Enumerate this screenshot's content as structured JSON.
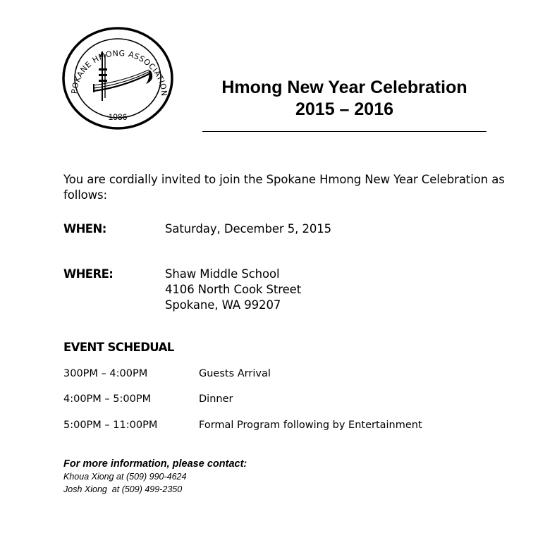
{
  "logo": {
    "arc_text": "SPOKANE HMONG ASSOCIATION",
    "year": "1986"
  },
  "title": {
    "line1": "Hmong New Year Celebration",
    "line2": "2015 – 2016"
  },
  "invitation": "You are cordially invited to join the Spokane Hmong New Year Celebration as follows:",
  "when": {
    "label": "WHEN:",
    "value": "Saturday, December 5, 2015"
  },
  "where": {
    "label": "WHERE:",
    "lines": [
      "Shaw Middle School",
      "4106 North Cook Street",
      "Spokane, WA  99207"
    ]
  },
  "schedule": {
    "heading": "EVENT SCHEDUAL",
    "items": [
      {
        "time": "300PM – 4:00PM",
        "event": "Guests Arrival"
      },
      {
        "time": "4:00PM – 5:00PM",
        "event": "Dinner"
      },
      {
        "time": "5:00PM – 11:00PM",
        "event": "Formal Program following by Entertainment"
      }
    ]
  },
  "contact": {
    "heading": "For more information, please contact:",
    "lines": [
      "Khoua Xiong at (509) 990-4624",
      "Josh Xiong  at (509) 499-2350"
    ]
  }
}
